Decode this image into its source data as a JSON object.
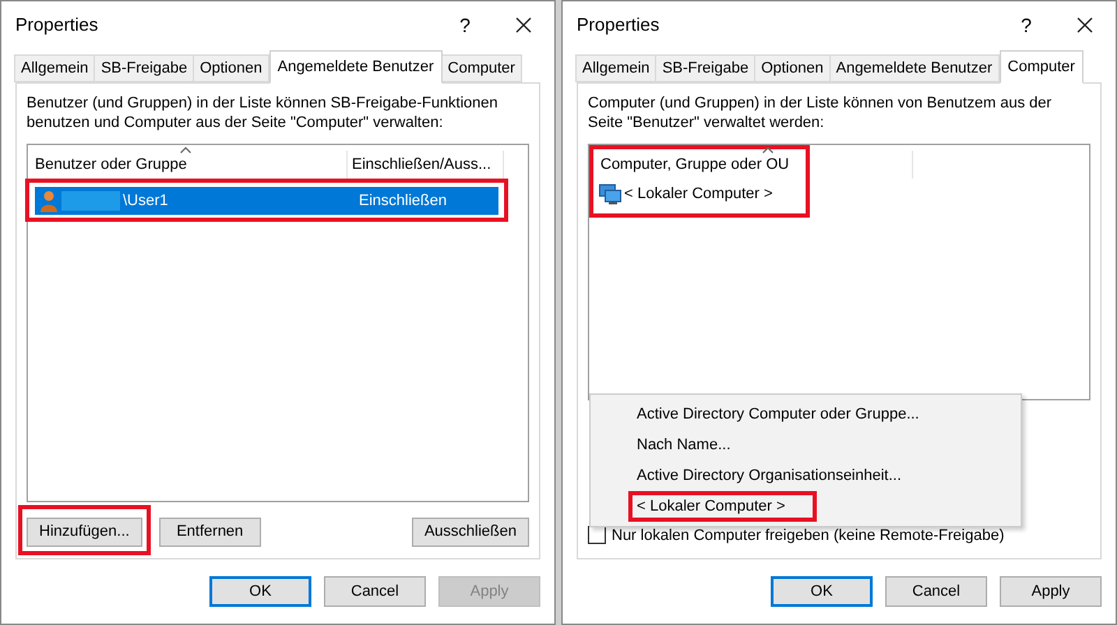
{
  "dialogs": [
    {
      "title": "Properties",
      "help": "?",
      "tabs": [
        {
          "label": "Allgemein",
          "selected": false
        },
        {
          "label": "SB-Freigabe",
          "selected": false
        },
        {
          "label": "Optionen",
          "selected": false
        },
        {
          "label": "Angemeldete Benutzer",
          "selected": true
        },
        {
          "label": "Computer",
          "selected": false
        }
      ],
      "description": "Benutzer (und Gruppen) in der Liste können SB-Freigabe-Funktionen benutzen und Computer aus der Seite \"Computer\" verwalten:",
      "list": {
        "highlighted": false,
        "columns": [
          "Benutzer oder Gruppe",
          "Einschließen/Auss..."
        ],
        "rows": [
          {
            "kind": "user",
            "cells": [
              "\\User1",
              "Einschließen"
            ],
            "selected": true,
            "highlighted": true
          }
        ]
      },
      "actions": [
        {
          "label": "Hinzufügen...",
          "highlighted": true
        },
        {
          "label": "Entfernen",
          "highlighted": false
        },
        {
          "label": "Ausschließen",
          "highlighted": false
        }
      ],
      "buttons": [
        {
          "label": "OK",
          "default": true,
          "disabled": false
        },
        {
          "label": "Cancel",
          "default": false,
          "disabled": false
        },
        {
          "label": "Apply",
          "default": false,
          "disabled": true
        }
      ]
    },
    {
      "title": "Properties",
      "help": "?",
      "tabs": [
        {
          "label": "Allgemein",
          "selected": false
        },
        {
          "label": "SB-Freigabe",
          "selected": false
        },
        {
          "label": "Optionen",
          "selected": false
        },
        {
          "label": "Angemeldete Benutzer",
          "selected": false
        },
        {
          "label": "Computer",
          "selected": true
        }
      ],
      "description": "Computer (und Gruppen) in der Liste können von Benutzem aus der Seite \"Benutzer\" verwaltet werden:",
      "list": {
        "highlighted": true,
        "columns": [
          "Computer, Gruppe oder OU"
        ],
        "rows": [
          {
            "kind": "computer",
            "cells": [
              "< Lokaler Computer >"
            ],
            "selected": false,
            "highlighted": false
          }
        ]
      },
      "menu": [
        {
          "label": "Active Directory Computer oder Gruppe...",
          "highlighted": false
        },
        {
          "label": "Nach Name...",
          "highlighted": false
        },
        {
          "label": "Active Directory Organisationseinheit...",
          "highlighted": false
        },
        {
          "label": "< Lokaler Computer >",
          "highlighted": true
        }
      ],
      "checkbox": {
        "label": "Nur lokalen Computer freigeben (keine Remote-Freigabe)",
        "checked": false
      },
      "buttons": [
        {
          "label": "OK",
          "default": true,
          "disabled": false
        },
        {
          "label": "Cancel",
          "default": false,
          "disabled": false
        },
        {
          "label": "Apply",
          "default": false,
          "disabled": false
        }
      ]
    }
  ]
}
